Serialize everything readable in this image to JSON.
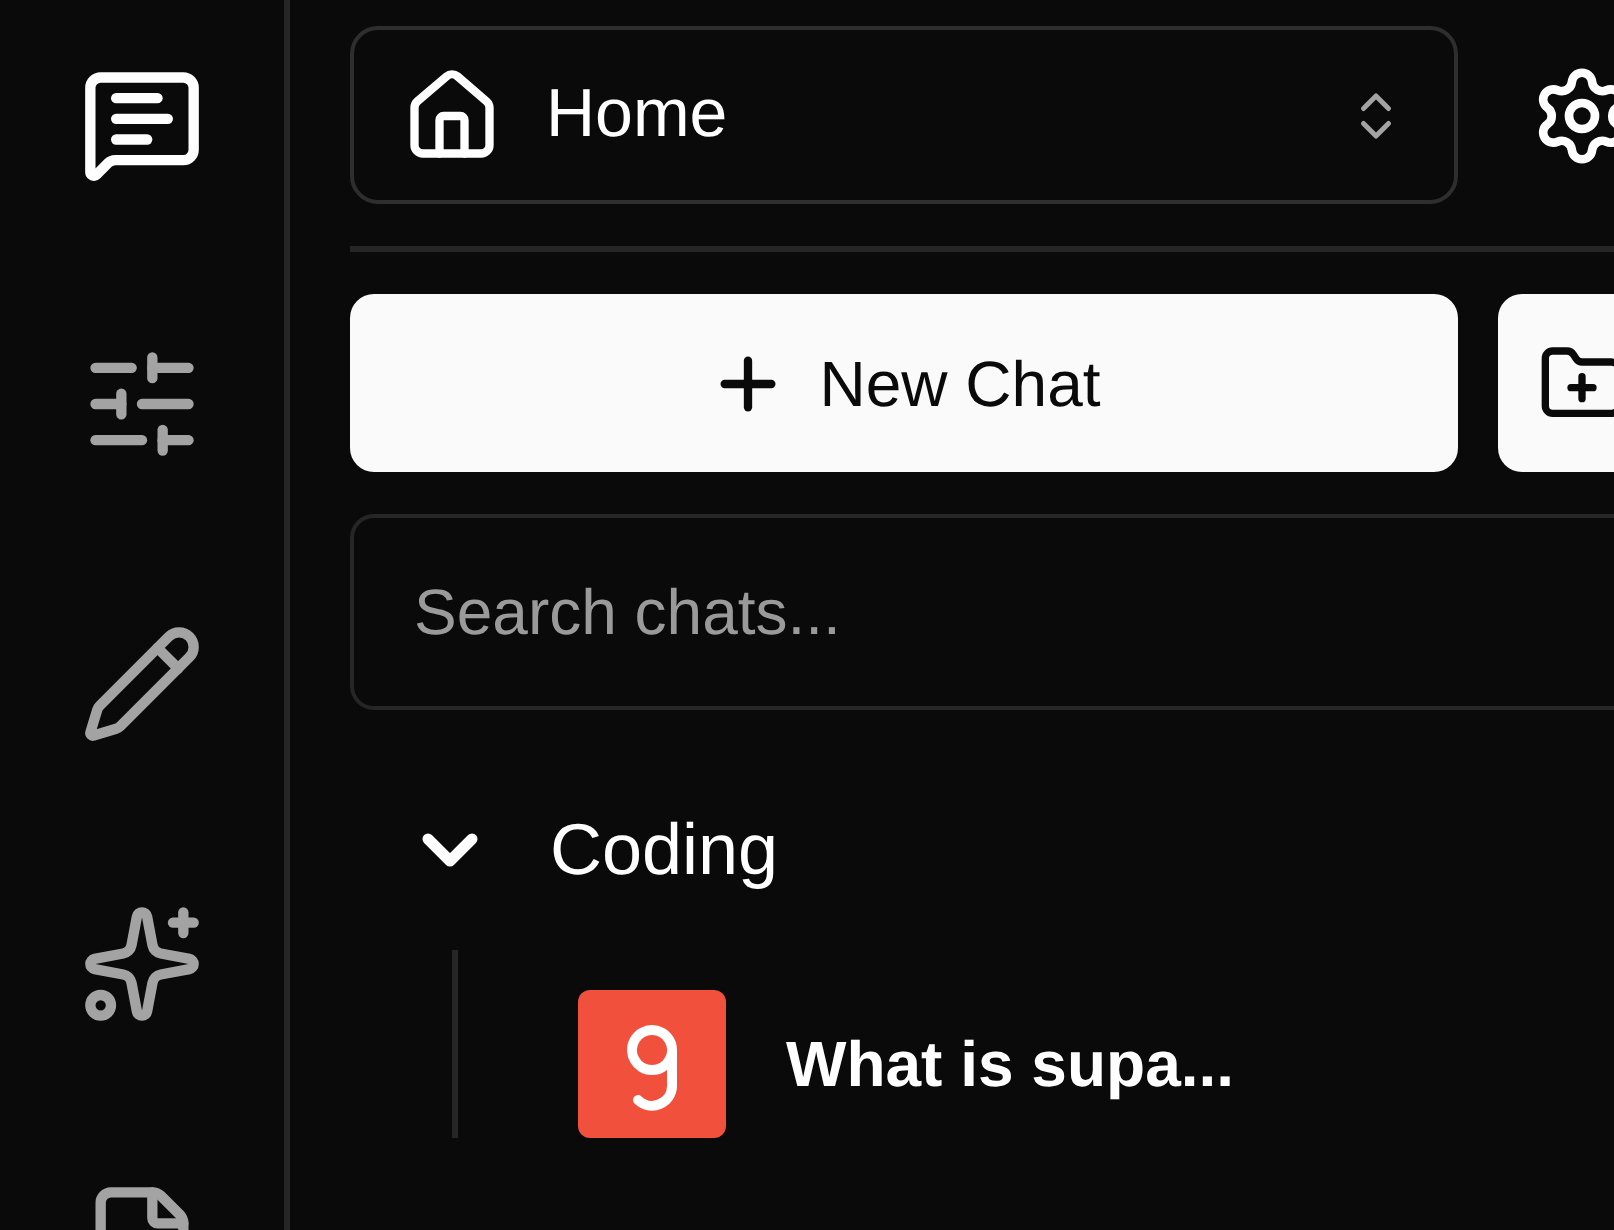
{
  "space_selector": {
    "label": "Home"
  },
  "new_chat_button": {
    "label": "New Chat"
  },
  "search": {
    "placeholder": "Search chats..."
  },
  "folders": [
    {
      "name": "Coding",
      "expanded": true,
      "chats": [
        {
          "title": "What is supa..."
        }
      ]
    }
  ]
}
